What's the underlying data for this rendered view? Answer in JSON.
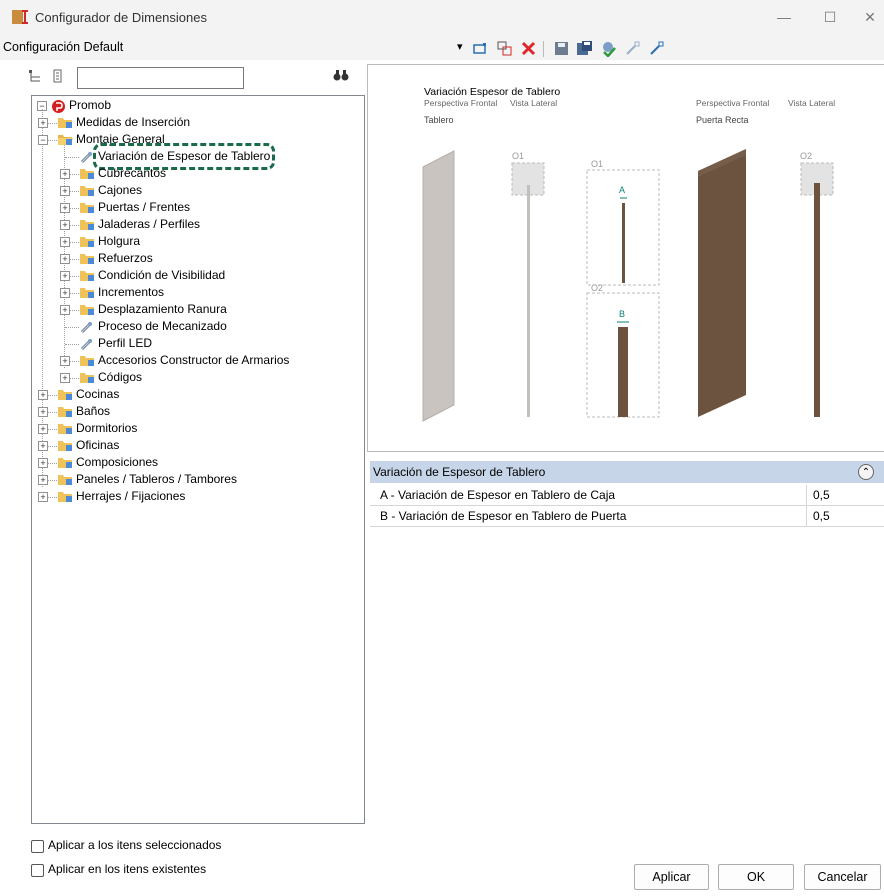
{
  "window": {
    "title": "Configurador de Dimensiones",
    "minimize_glyph": "—",
    "maximize_glyph": "☐",
    "close_glyph": "✕"
  },
  "config": {
    "label": "Configuración Default",
    "dropdown_glyph": "▾"
  },
  "toolbar_icons": [
    "add-icon",
    "copy-icon",
    "delete-icon",
    "save-icon",
    "save-as-icon",
    "config-icon",
    "import-icon",
    "export-icon"
  ],
  "search": {
    "value": "",
    "find_glyph": "🔍"
  },
  "tree": {
    "root": "Promob",
    "items": [
      {
        "label": "Medidas de Inserción"
      },
      {
        "label": "Montaje General"
      },
      {
        "label": "Variación de Espesor de Tablero"
      },
      {
        "label": "Cubrecantos"
      },
      {
        "label": "Cajones"
      },
      {
        "label": "Puertas / Frentes"
      },
      {
        "label": "Jaladeras / Perfiles"
      },
      {
        "label": "Holgura"
      },
      {
        "label": "Refuerzos"
      },
      {
        "label": "Condición de Visibilidad"
      },
      {
        "label": "Incrementos"
      },
      {
        "label": "Desplazamiento Ranura"
      },
      {
        "label": "Proceso de Mecanizado"
      },
      {
        "label": "Perfil LED"
      },
      {
        "label": "Accesorios Constructor de Armarios"
      },
      {
        "label": "Códigos"
      },
      {
        "label": "Cocinas"
      },
      {
        "label": "Baños"
      },
      {
        "label": "Dormitorios"
      },
      {
        "label": "Oficinas"
      },
      {
        "label": "Composiciones"
      },
      {
        "label": "Paneles / Tableros / Tambores"
      },
      {
        "label": "Herrajes / Fijaciones"
      }
    ]
  },
  "preview": {
    "title": "Variación Espesor de Tablero",
    "persp_front_1": "Perspectiva Frontal",
    "vista_lateral_1": "Vista Lateral",
    "persp_front_2": "Perspectiva Frontal",
    "vista_lateral_2": "Vista Lateral",
    "tablero": "Tablero",
    "puerta_recta": "Puerta Recta",
    "o1_a": "O1",
    "o1_b": "O1",
    "o2_a": "O2",
    "o2_b": "O2",
    "label_a": "A",
    "label_b": "B"
  },
  "properties": {
    "header": "Variación de Espesor de Tablero",
    "collapse_glyph": "⌃",
    "rows": [
      {
        "name": "A - Variación de Espesor en Tablero de Caja",
        "value": "0,5"
      },
      {
        "name": "B - Variación de Espesor en Tablero de Puerta",
        "value": "0,5"
      }
    ]
  },
  "options": {
    "apply_selected": "Aplicar a los itens seleccionados",
    "apply_existing": "Aplicar en los itens existentes"
  },
  "buttons": {
    "apply": "Aplicar",
    "ok": "OK",
    "cancel": "Cancelar"
  },
  "colors": {
    "highlight_dash": "#1a6b4a",
    "wood": "#6b533f",
    "panel_gray": "#c9c4bf",
    "header_blue": "#c7d5e8"
  }
}
